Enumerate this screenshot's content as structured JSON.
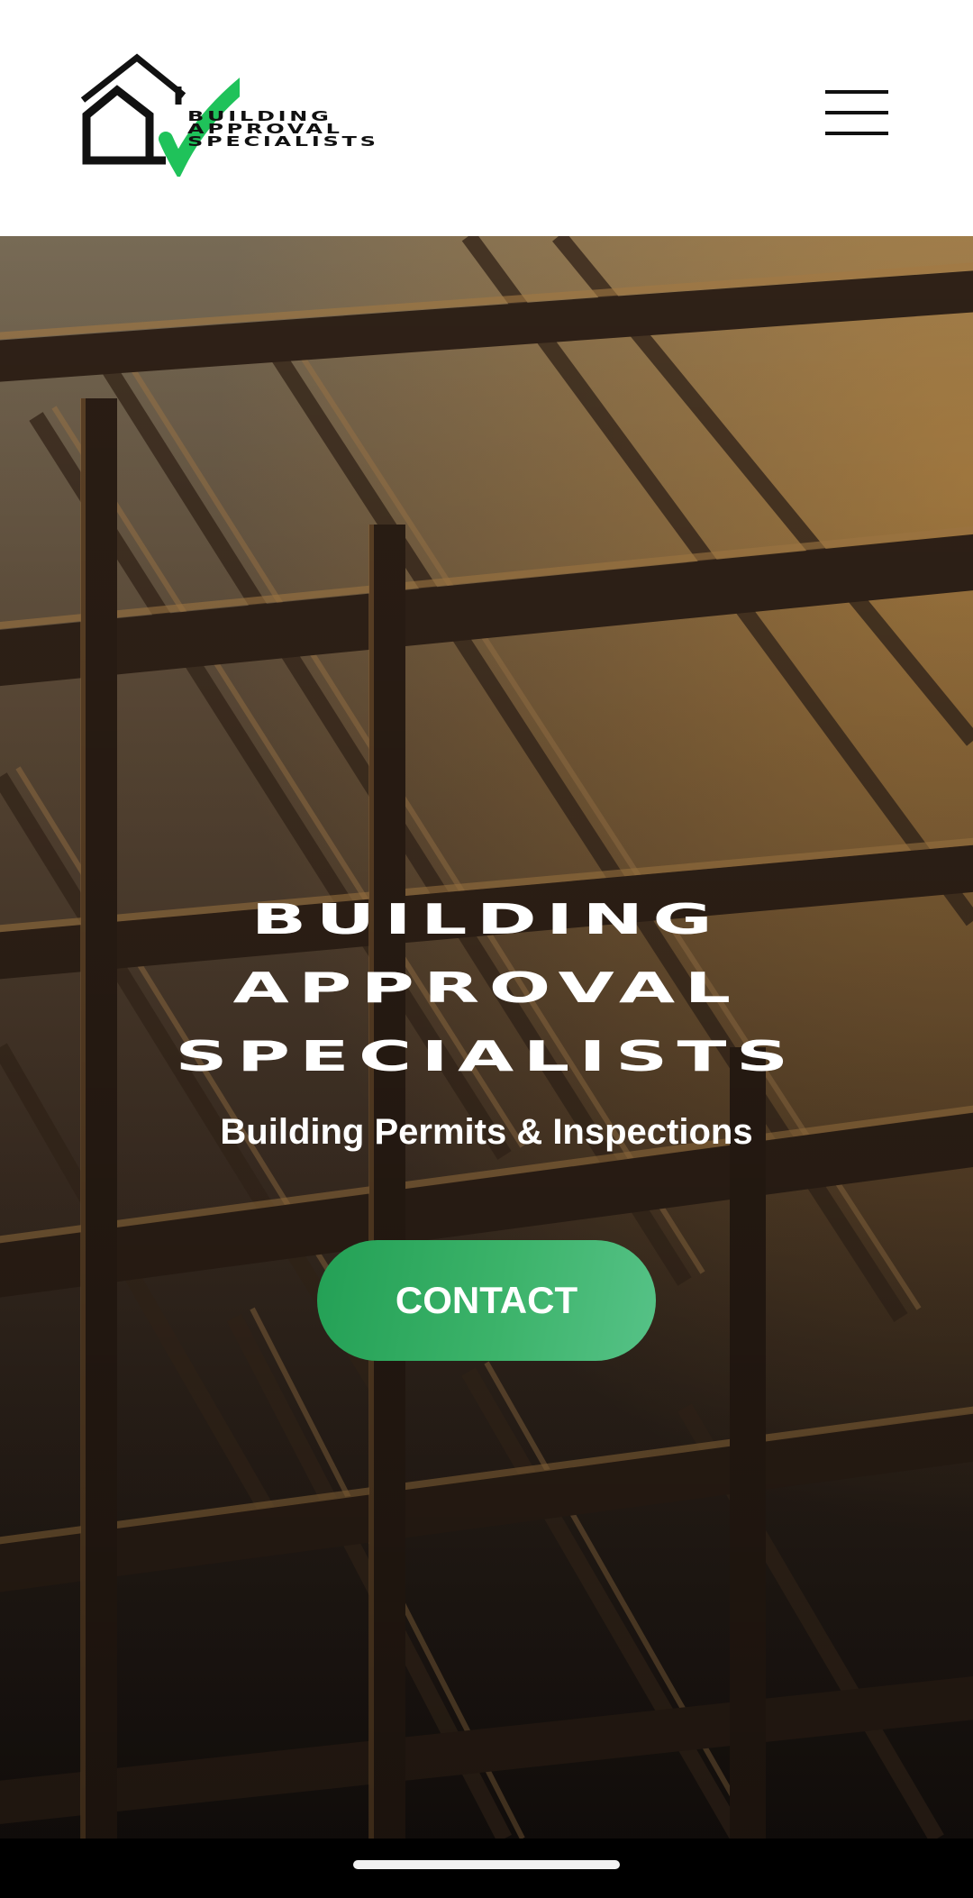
{
  "header": {
    "logo_lines": [
      "BUILDING",
      "APPROVAL",
      "SPECIALISTS"
    ],
    "logo_icons": [
      "house-icon",
      "checkmark-icon"
    ],
    "menu_icon": "hamburger-menu-icon"
  },
  "hero": {
    "title_lines": [
      "BUILDING",
      "APPROVAL",
      "SPECIALISTS"
    ],
    "subtitle": "Building Permits & Inspections",
    "cta_label": "CONTACT",
    "background": "steel-beam-structure-photo"
  },
  "colors": {
    "accent": "#2eaa5f",
    "header_bg": "#ffffff",
    "text_dark": "#111111",
    "text_light": "#ffffff"
  }
}
